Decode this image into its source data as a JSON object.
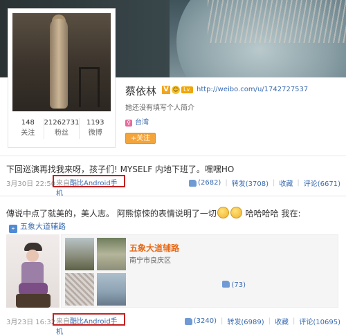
{
  "profile": {
    "name": "蔡依林",
    "v_badge": "V",
    "level_badge": "Lv.",
    "url": "http://weibo.com/u/1742727537",
    "intro": "她还没有填写个人简介",
    "location": "台湾",
    "gender_symbol": "♀",
    "follow_label": "+关注",
    "stats": [
      {
        "value": "148",
        "label": "关注"
      },
      {
        "value": "21262731",
        "label": "粉丝"
      },
      {
        "value": "1193",
        "label": "微博"
      }
    ]
  },
  "posts": [
    {
      "text": "下回巡演再找我来呀，孩子们! MYSELF 内地下班了。嘿嘿HO",
      "date": "3月30日 22:50",
      "source_prefix": "来自",
      "source_client": "酷比Android手机",
      "likes": "(2682)",
      "repost": "转发(3708)",
      "favorite": "收藏",
      "comment": "评论(6671)"
    },
    {
      "text_a": "傳说中点了就美的，美人志。 阿熊惊悚的表情说明了一切",
      "text_b": "哈哈哈哈 我在:",
      "poi_link": "五象大道辅路",
      "poi_name": "五象大道辅路",
      "poi_address": "南宁市良庆区",
      "poi_likes": "(73)",
      "date": "3月23日 16:32",
      "source_prefix": "来自",
      "source_client": "酷比Android手机",
      "likes": "(3240)",
      "repost": "转发(6989)",
      "favorite": "收藏",
      "comment": "评论(10695)"
    }
  ],
  "colors": {
    "link": "#3b6cb1",
    "highlight_box": "#c42020",
    "follow_button": "#f3a43a",
    "poi_title": "#e56b1a"
  },
  "icons": [
    "verified-v-icon",
    "smile-icon",
    "level-icon",
    "gender-female-icon",
    "thumbs-up-icon",
    "location-pin-icon",
    "emoji-icon"
  ]
}
